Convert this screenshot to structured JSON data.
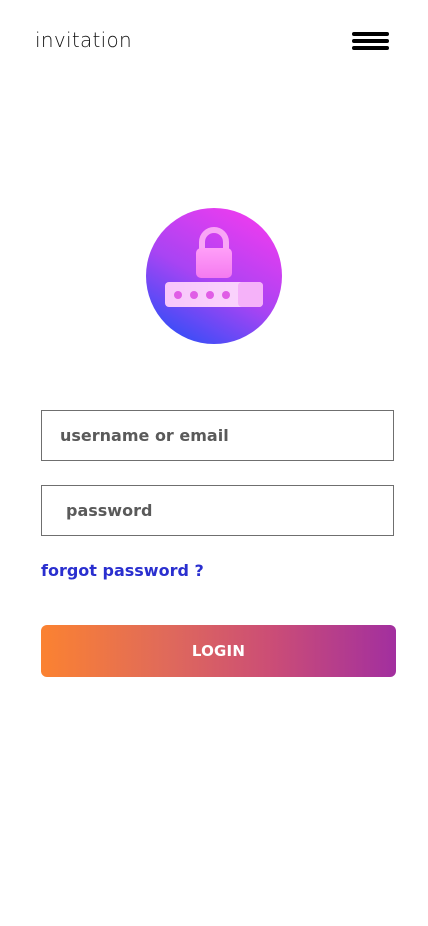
{
  "header": {
    "app_title": "invitation",
    "menu_icon": "hamburger-menu-icon"
  },
  "hero": {
    "icon": "password-lock-icon"
  },
  "form": {
    "username_placeholder": "username or email",
    "username_value": "",
    "password_placeholder": "password",
    "password_value": "",
    "forgot_label": "forgot password ?",
    "login_label": "LOGIN"
  },
  "colors": {
    "link": "#2a2fcf",
    "button_gradient_start": "#fb8231",
    "button_gradient_end": "#a22f9f",
    "badge_gradient_start": "#ea3cf0",
    "badge_gradient_end": "#3d4df7"
  }
}
